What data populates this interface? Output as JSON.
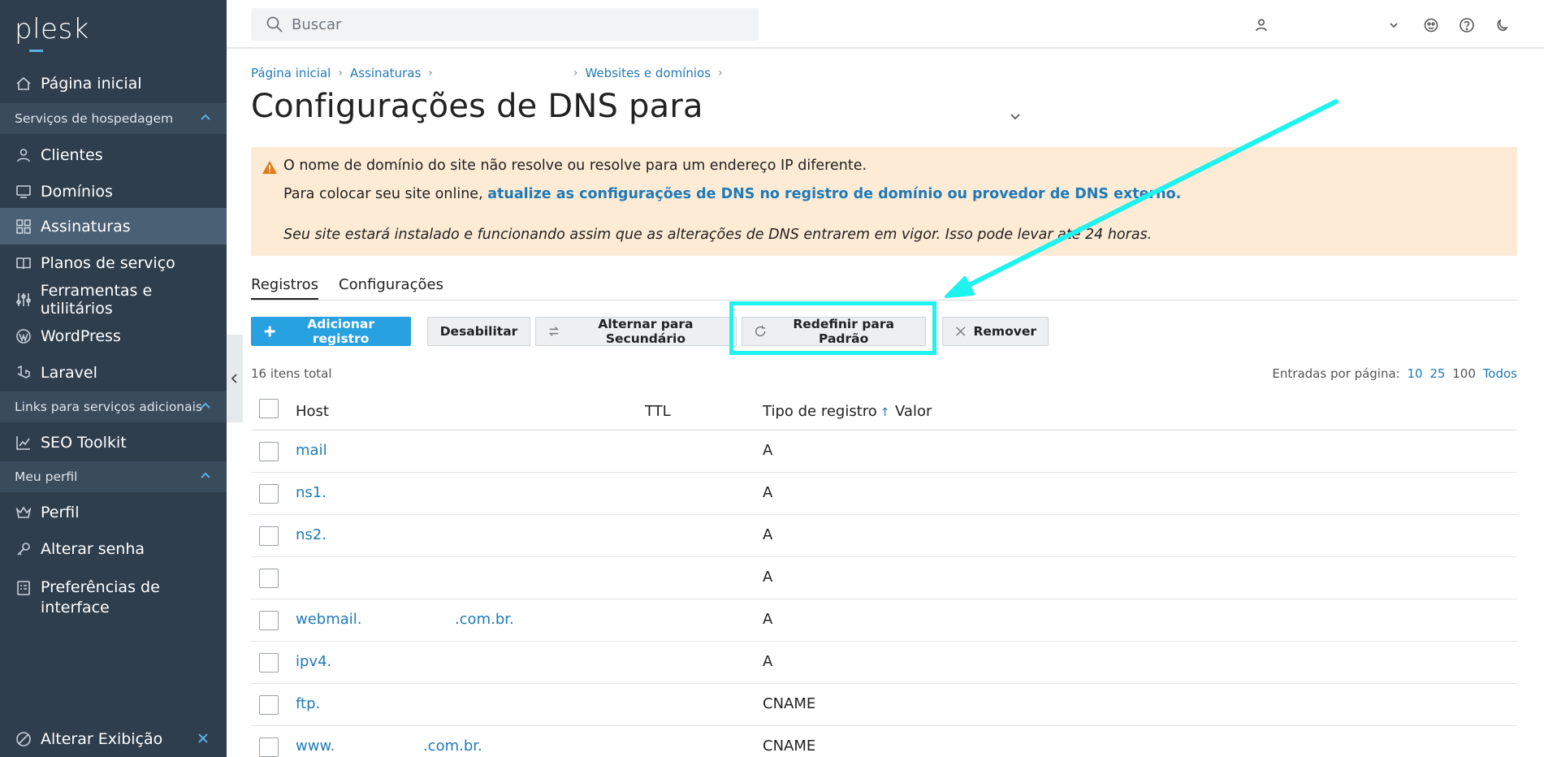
{
  "sidebar": {
    "logo": "plesk",
    "items": [
      {
        "label": "Página inicial",
        "icon": "home-icon"
      },
      {
        "section": "Serviços de hospedagem"
      },
      {
        "label": "Clientes",
        "icon": "user-icon"
      },
      {
        "label": "Domínios",
        "icon": "monitor-icon"
      },
      {
        "label": "Assinaturas",
        "icon": "grid-icon",
        "active": true
      },
      {
        "label": "Planos de serviço",
        "icon": "book-icon"
      },
      {
        "label": "Ferramentas e utilitários",
        "icon": "tools-icon"
      },
      {
        "label": "WordPress",
        "icon": "wordpress-icon"
      },
      {
        "label": "Laravel",
        "icon": "laravel-icon"
      },
      {
        "section": "Links para serviços adicionais"
      },
      {
        "label": "SEO Toolkit",
        "icon": "chart-icon"
      },
      {
        "section": "Meu perfil"
      },
      {
        "label": "Perfil",
        "icon": "crown-icon"
      },
      {
        "label": "Alterar senha",
        "icon": "key-icon"
      },
      {
        "label": "Preferências de interface",
        "icon": "settings-list-icon"
      }
    ],
    "footer_label": "Alterar Exibição"
  },
  "topbar": {
    "search_placeholder": "Buscar"
  },
  "breadcrumb": [
    "Página inicial",
    "Assinaturas",
    "Websites e domínios"
  ],
  "page_title": "Configurações de DNS para",
  "alert": {
    "line1": "O nome de domínio do site não resolve ou resolve para um endereço IP diferente.",
    "line2_prefix": "Para colocar seu site online, ",
    "line2_link": "atualize as configurações de DNS no registro de domínio ou provedor de DNS externo.",
    "line3": "Seu site estará instalado e funcionando assim que as alterações de DNS entrarem em vigor. Isso pode levar até 24 horas."
  },
  "tabs": [
    {
      "label": "Registros",
      "active": true
    },
    {
      "label": "Configurações",
      "active": false
    }
  ],
  "toolbar": {
    "add": "Adicionar registro",
    "disable": "Desabilitar",
    "switch_secondary": "Alternar para Secundário",
    "reset_default": "Redefinir para Padrão",
    "remove": "Remover"
  },
  "list": {
    "total": "16 itens total",
    "per_page_label": "Entradas por página:",
    "per_page_options": [
      "10",
      "25",
      "100",
      "Todos"
    ],
    "per_page_current": "100"
  },
  "table": {
    "columns": [
      "Host",
      "TTL",
      "Tipo de registro",
      "Valor"
    ],
    "sort_arrow": "↑",
    "rows": [
      {
        "host": "mail",
        "type": "A"
      },
      {
        "host": "ns1.",
        "type": "A"
      },
      {
        "host": "ns2.",
        "type": "A"
      },
      {
        "host": "",
        "type": "A"
      },
      {
        "host": "webmail.                    .com.br.",
        "type": "A"
      },
      {
        "host": "ipv4.",
        "type": "A"
      },
      {
        "host": "ftp.",
        "type": "CNAME"
      },
      {
        "host": "www.                   .com.br.",
        "type": "CNAME"
      }
    ]
  },
  "colors": {
    "sidebar_bg": "#2f3e4d",
    "active_bg": "#4a6075",
    "accent": "#27a1e0",
    "link": "#1f7ab8",
    "alert_bg": "#fdebd5",
    "annotation": "#1ff3ef"
  }
}
